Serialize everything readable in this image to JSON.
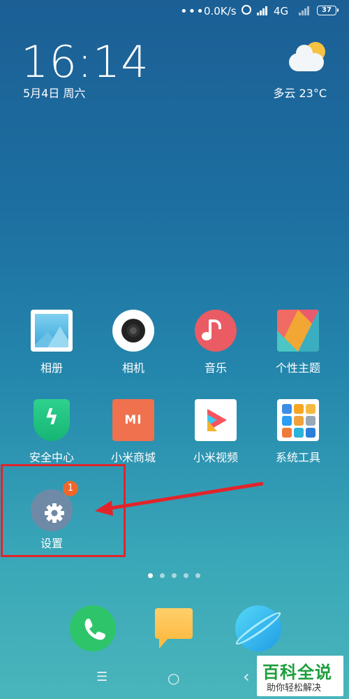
{
  "status_bar": {
    "dots": "•••",
    "speed": "0.0K/s",
    "network": "4G",
    "battery": "37"
  },
  "clock": {
    "time": "16:14",
    "date": "5月4日 周六"
  },
  "weather": {
    "text": "多云  23°C",
    "icon": "partly-cloudy-icon"
  },
  "apps": [
    {
      "label": "相册",
      "icon": "gallery-icon"
    },
    {
      "label": "相机",
      "icon": "camera-icon"
    },
    {
      "label": "音乐",
      "icon": "music-icon"
    },
    {
      "label": "个性主题",
      "icon": "themes-icon"
    },
    {
      "label": "安全中心",
      "icon": "security-icon"
    },
    {
      "label": "小米商城",
      "icon": "mi-store-icon"
    },
    {
      "label": "小米视频",
      "icon": "mi-video-icon"
    },
    {
      "label": "系统工具",
      "icon": "system-tools-folder-icon"
    }
  ],
  "settings_app": {
    "label": "设置",
    "badge": "1",
    "icon": "gear-icon"
  },
  "page_indicator": {
    "count": 5,
    "active": 1
  },
  "dock": [
    {
      "name": "phone",
      "icon": "phone-icon"
    },
    {
      "name": "messages",
      "icon": "message-icon"
    },
    {
      "name": "browser",
      "icon": "browser-icon"
    }
  ],
  "nav": {
    "menu": "☰",
    "home": "○",
    "back": "‹"
  },
  "watermark": {
    "title": "百科全说",
    "subtitle": "助你轻松解决"
  },
  "colors": {
    "highlight": "#e2242a",
    "badge": "#f0672a"
  }
}
